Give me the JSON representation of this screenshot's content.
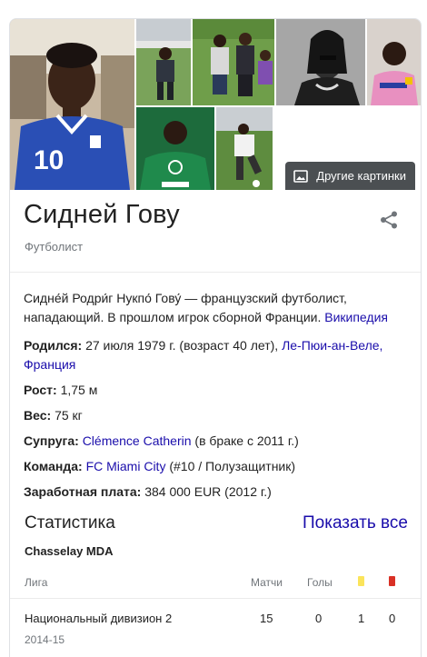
{
  "gallery": {
    "more_images_label": "Другие картинки",
    "icon": "image-icon"
  },
  "header": {
    "name": "Сидней Гову",
    "subtitle": "Футболист",
    "share_icon": "share-icon"
  },
  "description": {
    "text": "Сидне́й Родри́г Нукпо́ Гову́ — французский футболист, нападающий. В прошлом игрок сборной Франции.",
    "source_link": "Википедия"
  },
  "facts": {
    "born_label": "Родился:",
    "born_value": "27 июля 1979 г. (возраст 40 лет),",
    "born_place_link": "Ле-Пюи-ан-Веле, Франция",
    "height_label": "Рост:",
    "height_value": "1,75 м",
    "weight_label": "Вес:",
    "weight_value": "75 кг",
    "spouse_label": "Супруга:",
    "spouse_link": "Clémence Catherin",
    "spouse_note": "(в браке с 2011 г.)",
    "team_label": "Команда:",
    "team_link": "FC Miami City",
    "team_note": "(#10 / Полузащитник)",
    "salary_label": "Заработная плата:",
    "salary_value": "384 000 EUR (2012 г.)"
  },
  "stats": {
    "title": "Статистика",
    "show_all": "Показать все",
    "club": "Chasselay MDA",
    "columns": {
      "league": "Лига",
      "matches": "Матчи",
      "goals": "Голы"
    },
    "card_colors": {
      "yellow": "#fbe45b",
      "red": "#d93025"
    },
    "rows": [
      {
        "league": "Национальный дивизион 2",
        "matches": "15",
        "goals": "0",
        "yellow": "1",
        "red": "0",
        "season": "2014-15"
      }
    ]
  }
}
